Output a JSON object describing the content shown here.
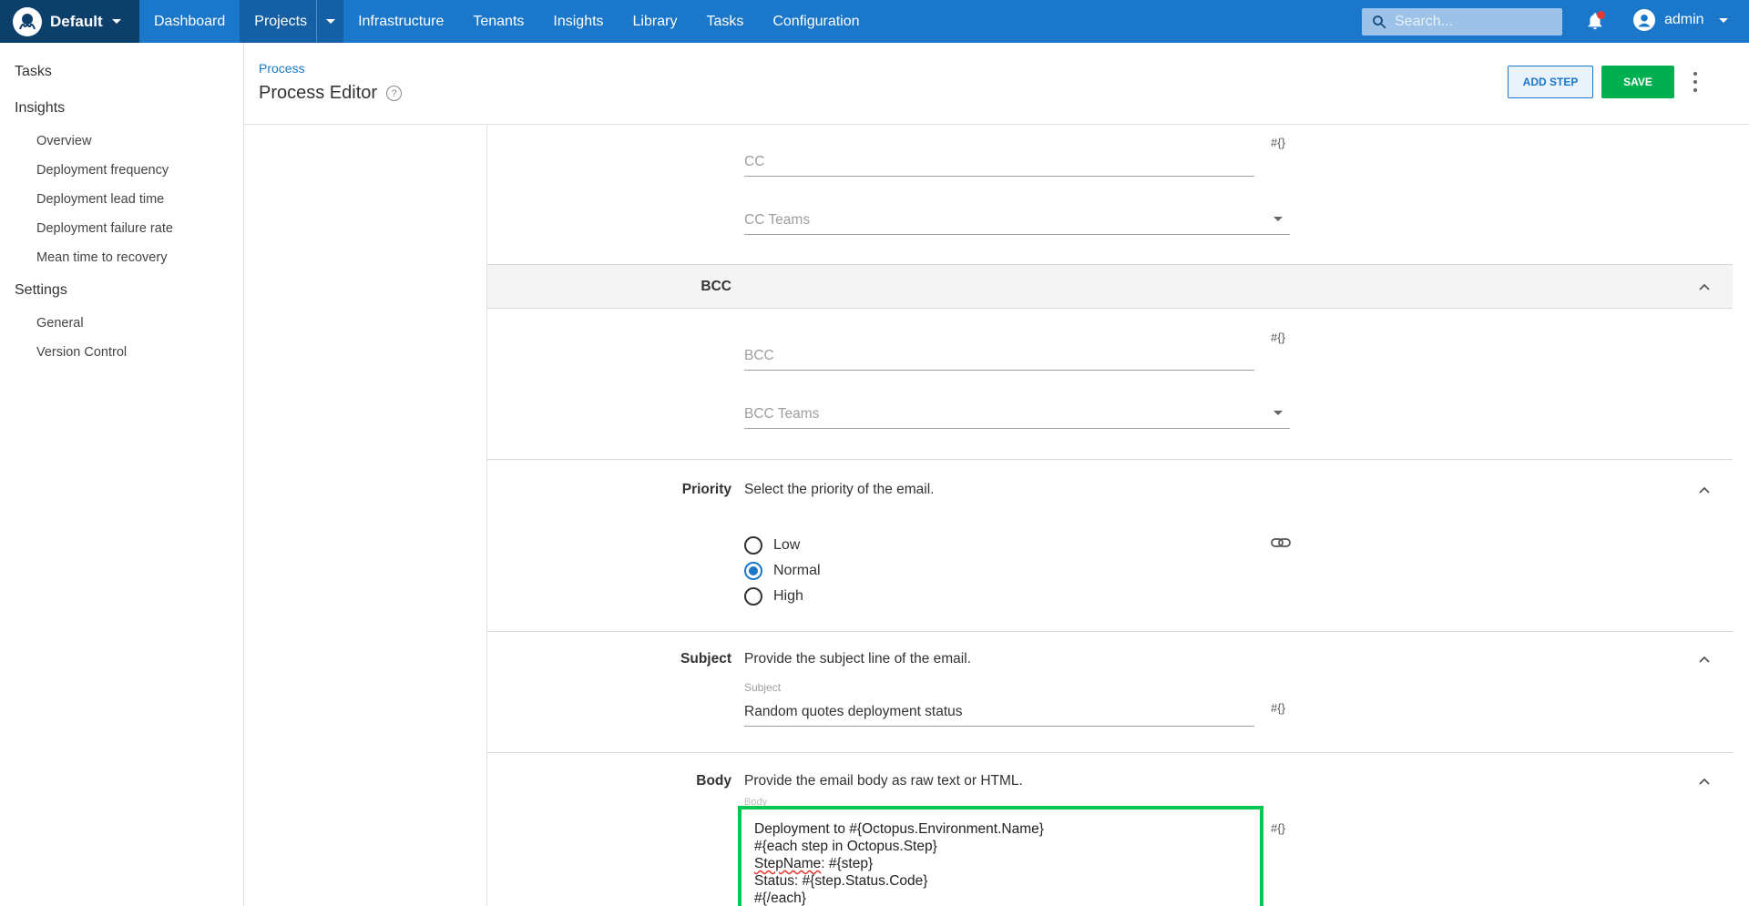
{
  "nav": {
    "space": "Default",
    "items": [
      "Dashboard",
      "Projects",
      "Infrastructure",
      "Tenants",
      "Insights",
      "Library",
      "Tasks",
      "Configuration"
    ],
    "search_placeholder": "Search...",
    "user": "admin",
    "colors": {
      "nav": "#1a77ca",
      "space_bg": "#0d3f6b",
      "active": "#1560a5"
    }
  },
  "sidebar": {
    "tasks": "Tasks",
    "insights": "Insights",
    "insight_items": [
      "Overview",
      "Deployment frequency",
      "Deployment lead time",
      "Deployment failure rate",
      "Mean time to recovery"
    ],
    "settings": "Settings",
    "settings_items": [
      "General",
      "Version Control"
    ]
  },
  "header": {
    "breadcrumb": "Process",
    "title": "Process Editor",
    "add_step": "ADD STEP",
    "save": "SAVE"
  },
  "cc": {
    "cc_placeholder": "CC",
    "cc_teams_placeholder": "CC Teams",
    "variable_icon": "#{}"
  },
  "bcc": {
    "label": "BCC",
    "bcc_placeholder": "BCC",
    "bcc_teams_placeholder": "BCC Teams",
    "variable_icon": "#{}"
  },
  "priority": {
    "label": "Priority",
    "description": "Select the priority of the email.",
    "options": [
      "Low",
      "Normal",
      "High"
    ],
    "selected": "Normal"
  },
  "subject": {
    "label": "Subject",
    "description": "Provide the subject line of the email.",
    "field_label": "Subject",
    "value": "Random quotes deployment status",
    "variable_icon": "#{}"
  },
  "body": {
    "label": "Body",
    "description": "Provide the email body as raw text or HTML.",
    "field_label": "Body",
    "lines": [
      "Deployment to #{Octopus.Environment.Name}",
      "#{each step in Octopus.Step}",
      "StepName: #{step}",
      "Status: #{step.Status.Code}",
      "#{/each}"
    ],
    "line3_misspelled": "StepName",
    "line3_rest": ": #{step}",
    "variable_icon": "#{}",
    "highlight_color": "#00c853"
  }
}
